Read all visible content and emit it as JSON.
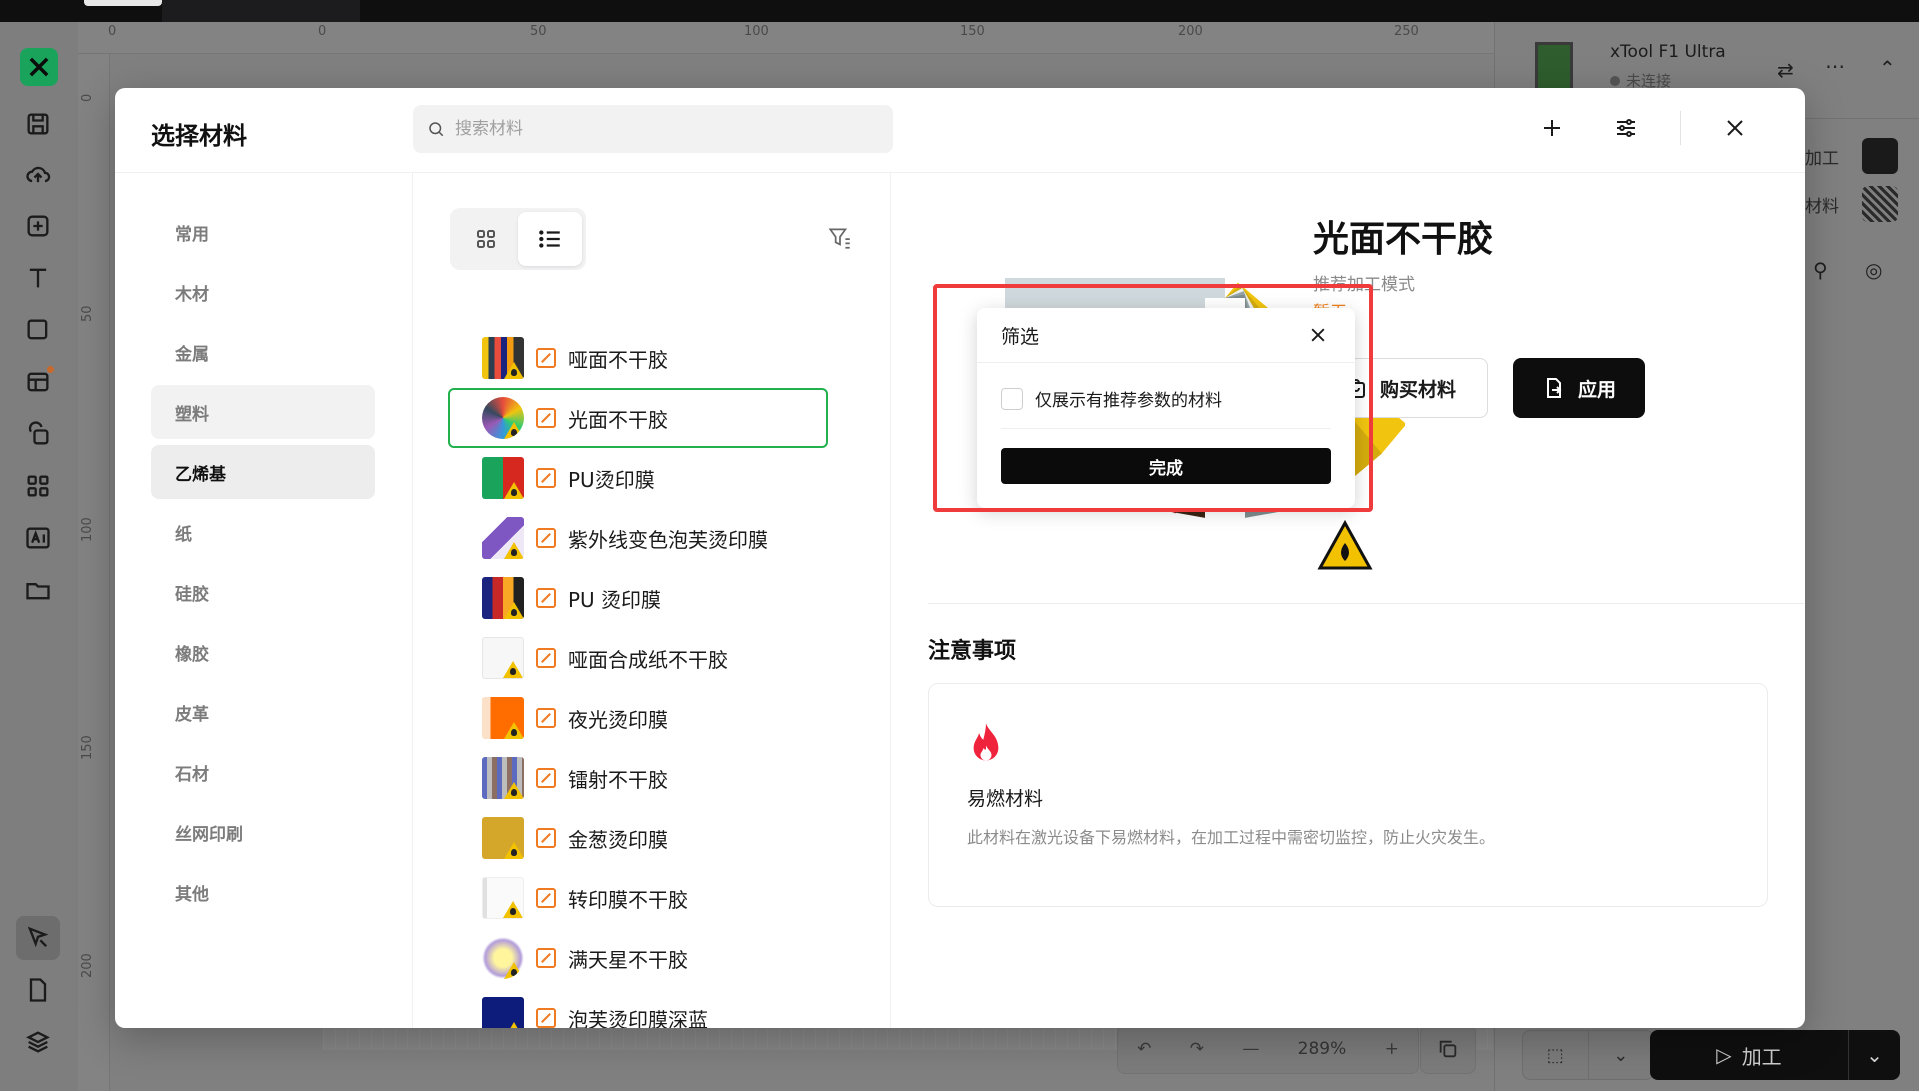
{
  "rulers": {
    "top_ticks": [
      "0",
      "0",
      "50",
      "100",
      "150",
      "200",
      "250"
    ],
    "left_ticks": [
      "0",
      "50",
      "100",
      "150",
      "200"
    ]
  },
  "right_panel": {
    "device_name": "xTool F1 Ultra",
    "device_status": "未连接",
    "process_label": "加工",
    "material_label": "材料"
  },
  "zoom": {
    "level": "289%"
  },
  "process_button": {
    "label": "加工"
  },
  "modal": {
    "title": "选择材料",
    "search_placeholder": "搜索材料",
    "categories": [
      {
        "label": "常用"
      },
      {
        "label": "木材"
      },
      {
        "label": "金属"
      },
      {
        "label": "塑料"
      },
      {
        "label": "乙烯基"
      },
      {
        "label": "纸"
      },
      {
        "label": "硅胶"
      },
      {
        "label": "橡胶"
      },
      {
        "label": "皮革"
      },
      {
        "label": "石材"
      },
      {
        "label": "丝网印刷"
      },
      {
        "label": "其他"
      }
    ],
    "materials": [
      {
        "name": "哑面不干胶"
      },
      {
        "name": "光面不干胶"
      },
      {
        "name": "PU烫印膜"
      },
      {
        "name": "紫外线变色泡芙烫印膜"
      },
      {
        "name": "PU 烫印膜"
      },
      {
        "name": "哑面合成纸不干胶"
      },
      {
        "name": "夜光烫印膜"
      },
      {
        "name": "镭射不干胶"
      },
      {
        "name": "金葱烫印膜"
      },
      {
        "name": "转印膜不干胶"
      },
      {
        "name": "满天星不干胶"
      },
      {
        "name": "泡芙烫印膜深蓝"
      }
    ],
    "detail": {
      "title": "光面不干胶",
      "mode_label": "推荐加工模式",
      "mode_value": "暂无",
      "buy_label": "购买材料",
      "apply_label": "应用",
      "notes_title": "注意事项",
      "notes_head": "易燃材料",
      "notes_body": "此材料在激光设备下易燃材料，在加工过程中需密切监控，防止火灾发生。"
    },
    "filter": {
      "title": "筛选",
      "checkbox_label": "仅展示有推荐参数的材料",
      "done_label": "完成"
    }
  },
  "colors": {
    "accent_green": "#22b14c",
    "highlight_red": "#ef3b3b",
    "warning_orange": "#ef7f1a",
    "flame_red": "#f0233c"
  }
}
